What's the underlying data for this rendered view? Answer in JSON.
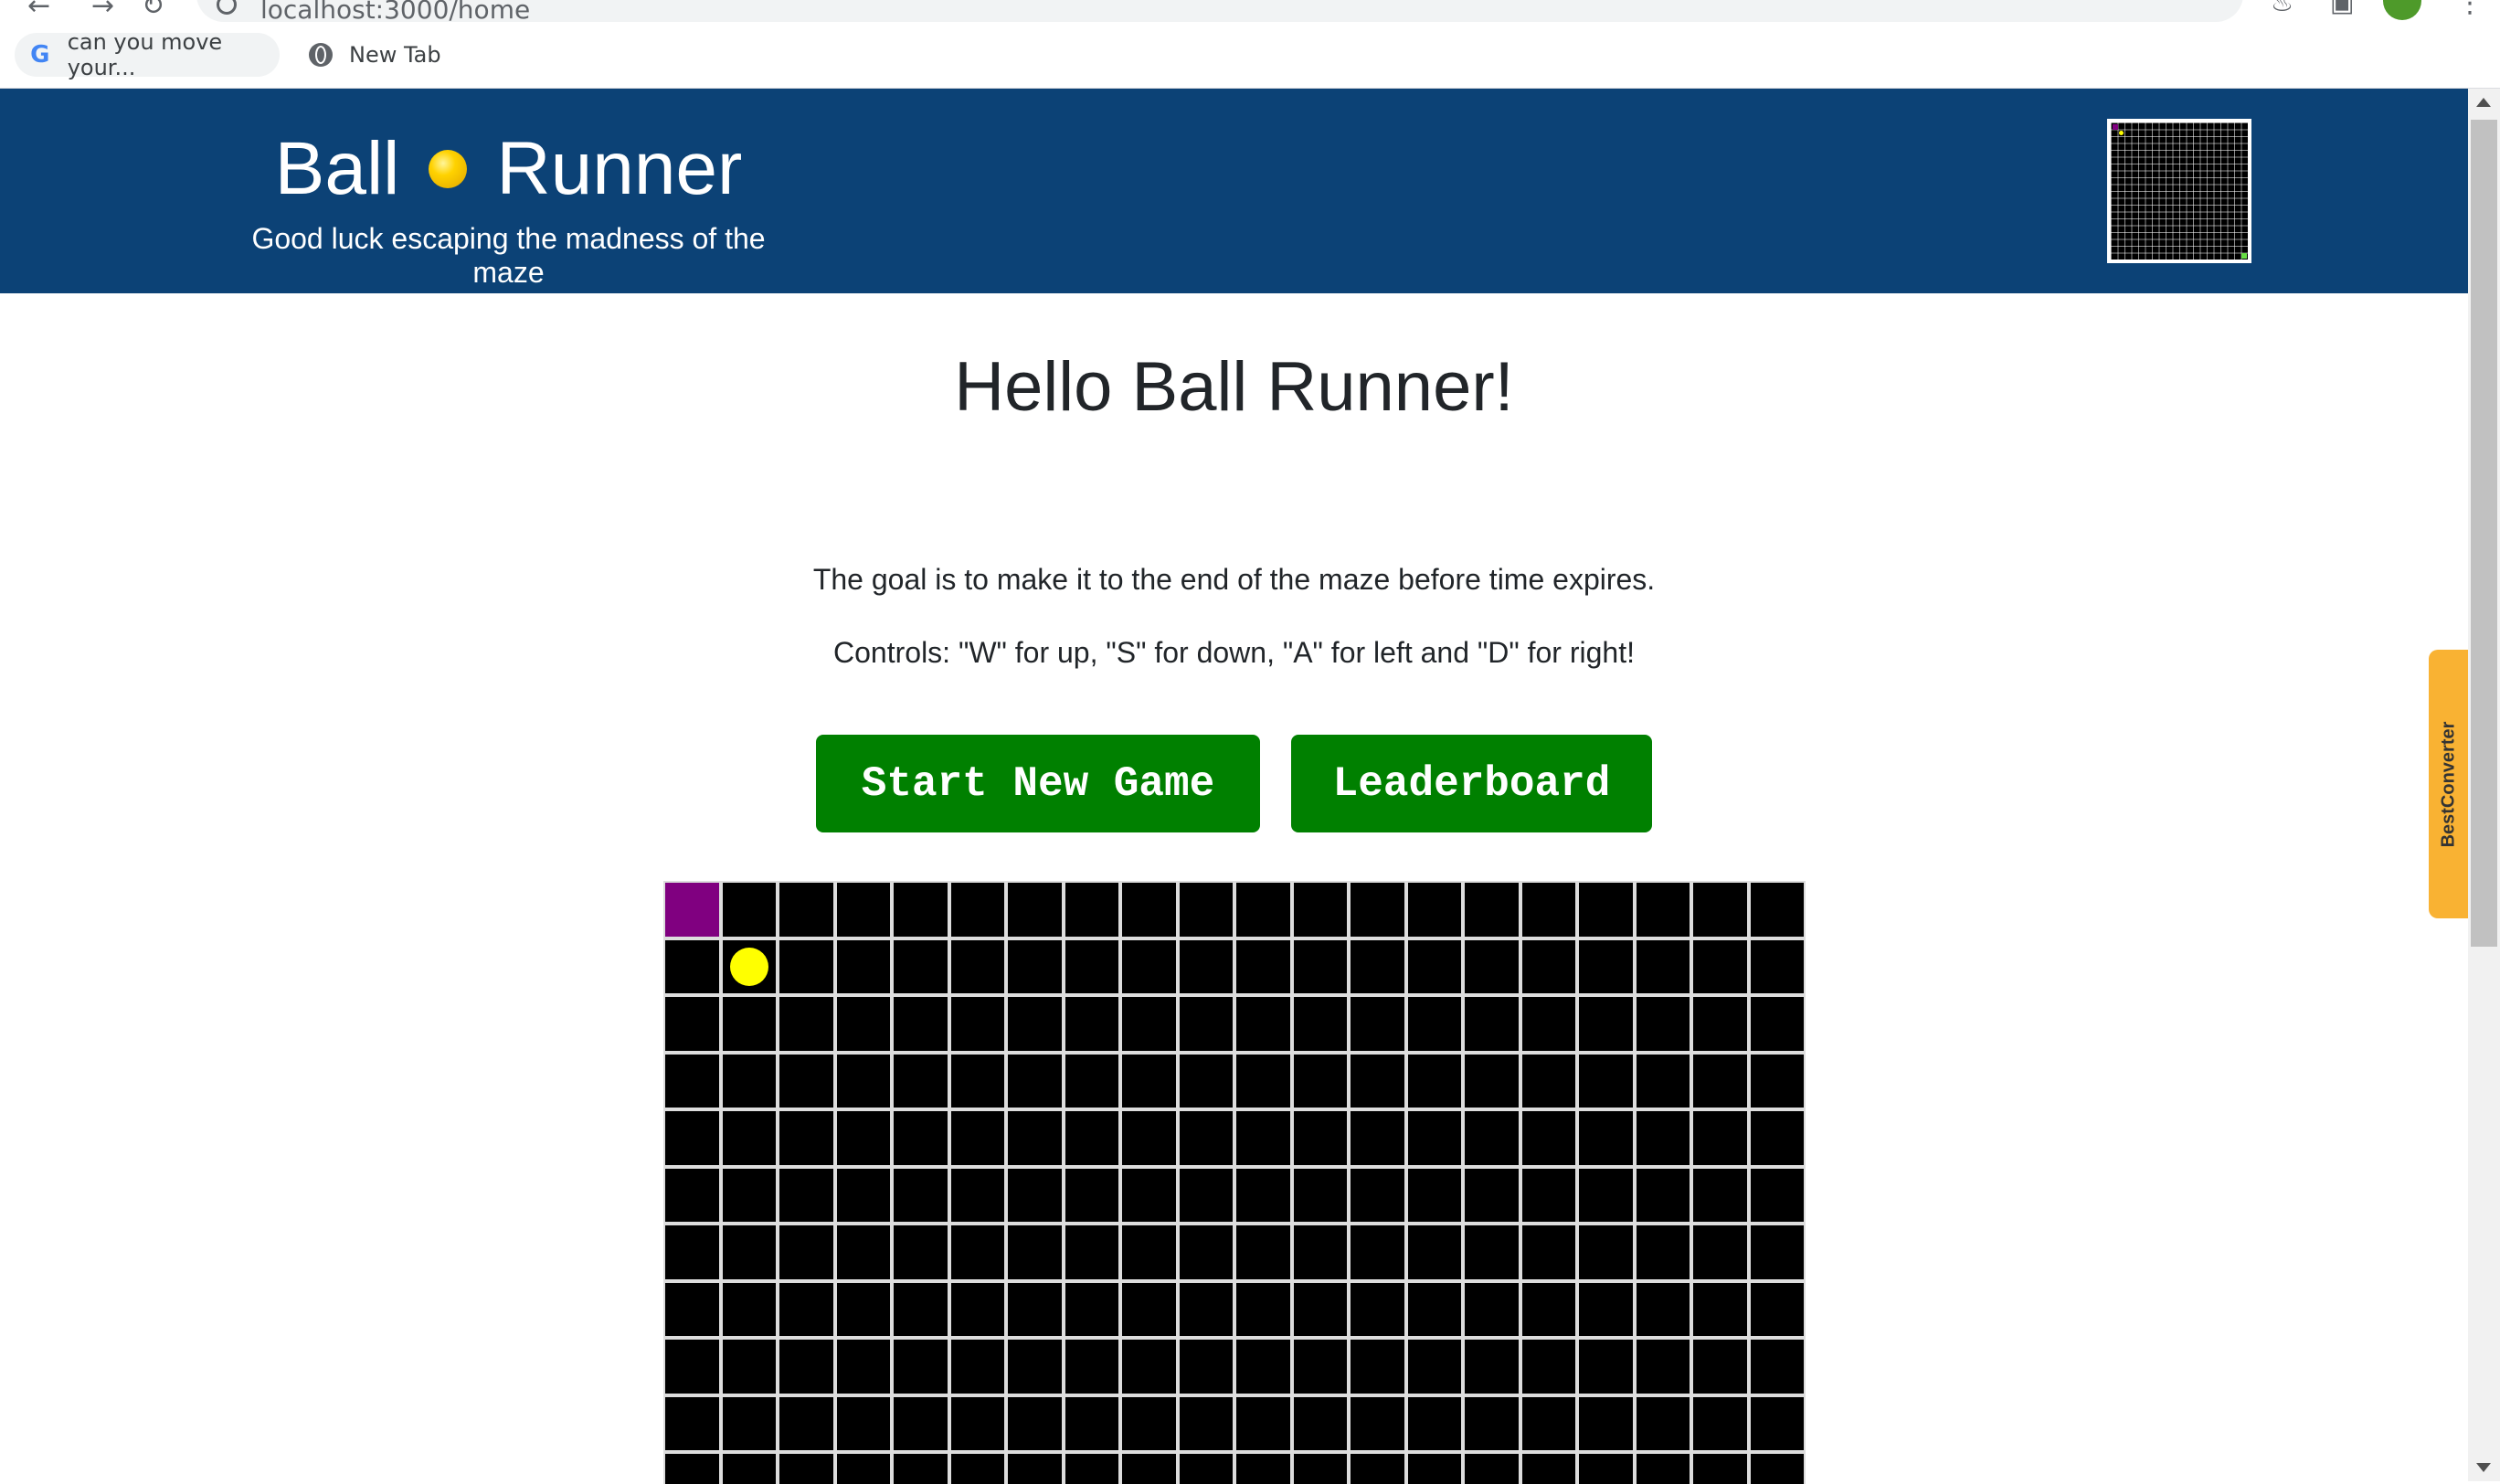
{
  "browser": {
    "url": "localhost:3000/home",
    "bookmarks": [
      {
        "label": "can you move your...",
        "icon": "google-icon"
      },
      {
        "label": "New Tab",
        "icon": "globe-icon"
      }
    ]
  },
  "header": {
    "title_left": "Ball",
    "title_right": "Runner",
    "tagline": "Good luck escaping the madness of the maze"
  },
  "main": {
    "heading": "Hello Ball Runner!",
    "goal": "The goal is to make it to the end of the maze before time expires.",
    "controls": "Controls: \"W\" for up, \"S\" for down, \"A\" for left and \"D\" for right!",
    "start_label": "Start New Game",
    "leaderboard_label": "Leaderboard"
  },
  "maze": {
    "columns": 20,
    "visible_rows": 11,
    "start_cell": {
      "row": 0,
      "col": 0
    },
    "ball_cell": {
      "row": 1,
      "col": 1
    },
    "colors": {
      "cell": "#000000",
      "wall": "#dddddd",
      "start": "#800080",
      "ball": "#ffff00",
      "header": "#0c4276",
      "button": "#008000"
    }
  },
  "extension": {
    "label": "BestConverter"
  }
}
